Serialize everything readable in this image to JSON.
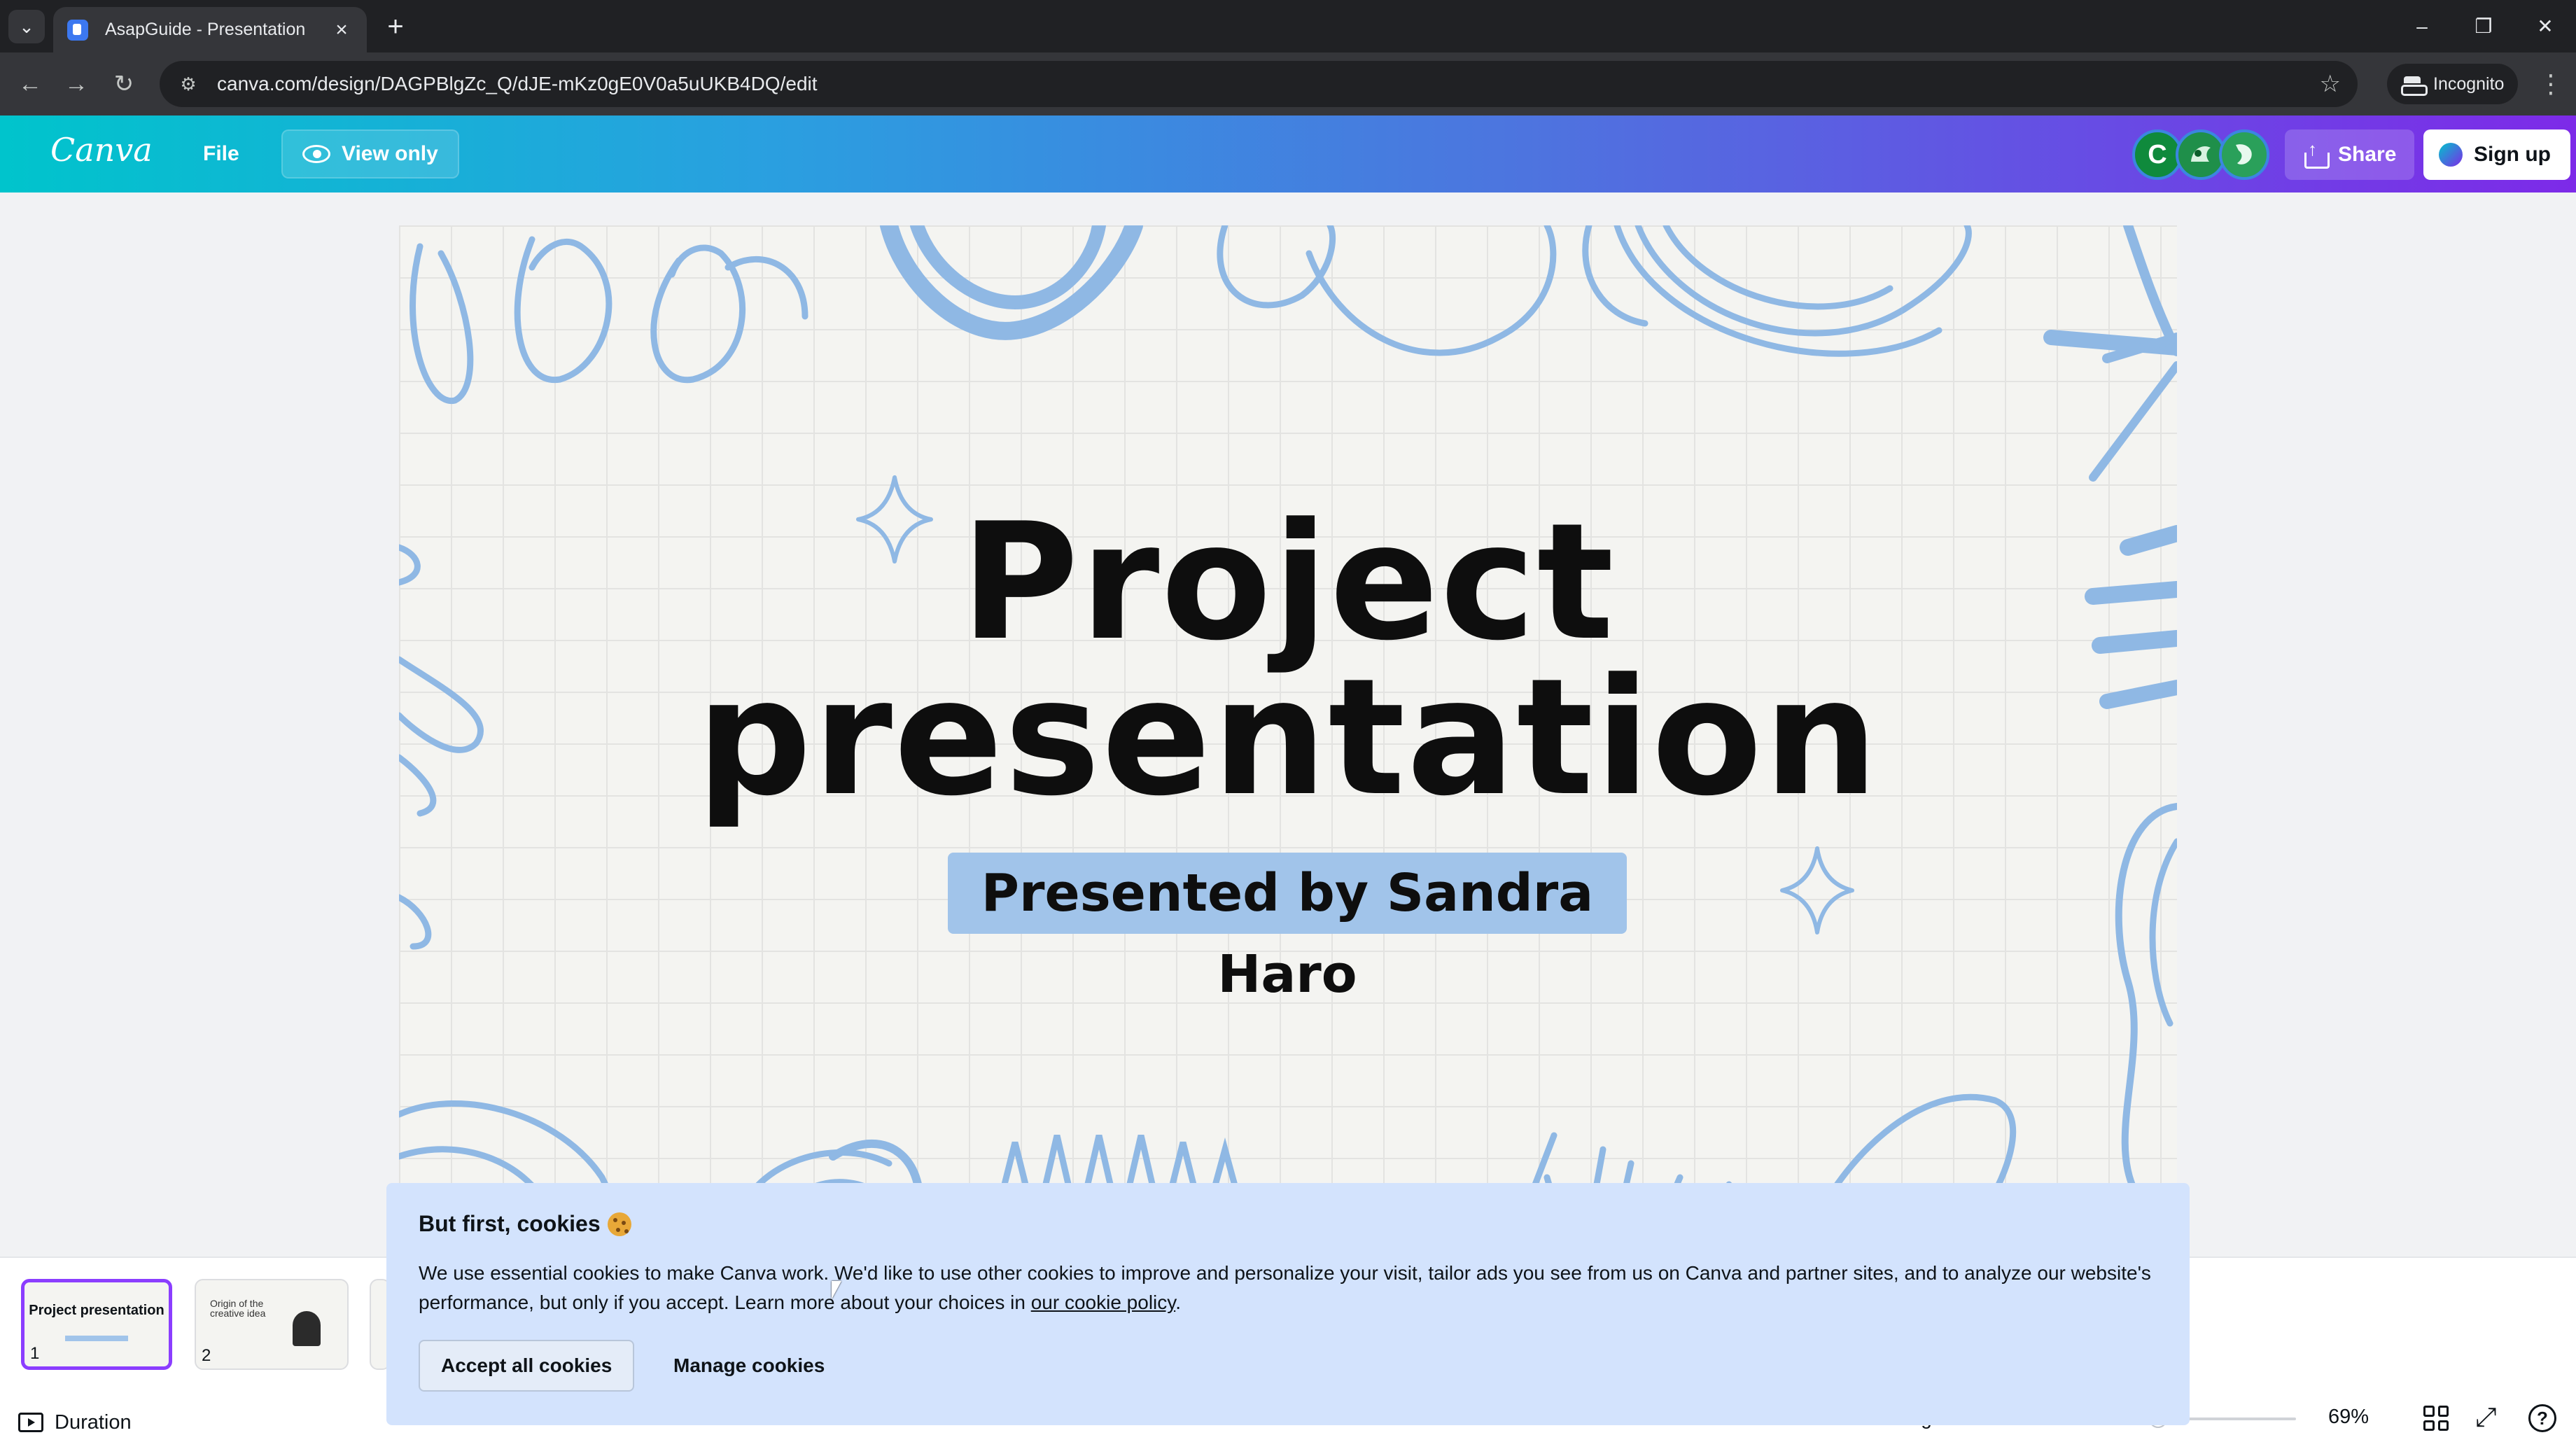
{
  "browser": {
    "tab_title": "AsapGuide - Presentation",
    "url": "canva.com/design/DAGPBlgZc_Q/dJE-mKz0gE0V0a5uUKB4DQ/edit",
    "incognito_label": "Incognito",
    "icons": [
      "tab-list-icon",
      "favicon-icon",
      "close-icon",
      "plus-icon",
      "minimize-icon",
      "restore-icon",
      "close-window-icon",
      "back-icon",
      "forward-icon",
      "reload-icon",
      "site-info-icon",
      "star-icon",
      "incognito-icon",
      "kebab-menu-icon"
    ]
  },
  "header": {
    "logo": "Canva",
    "file_label": "File",
    "view_only_label": "View only",
    "avatars": [
      {
        "initial": "C",
        "color": "#0f8a3c"
      },
      {
        "initial": "",
        "color": "#1f8f4a"
      },
      {
        "initial": "",
        "color": "#2aa05a"
      }
    ],
    "share_label": "Share",
    "signup_label": "Sign up",
    "gradient_colors": [
      "#00c4cc",
      "#4e73df",
      "#7d2ae8"
    ]
  },
  "slide": {
    "title_line1": "Project",
    "title_line2": "presentation",
    "subtitle": "Presented by Sandra Haro",
    "accent_color": "#a1c4ea",
    "doodle_color": "#8fb8e4"
  },
  "bottom": {
    "thumbnails": [
      {
        "number": "1",
        "title": "Project presentation",
        "active": true
      },
      {
        "number": "2",
        "title": "Origin of the creative idea",
        "active": false
      }
    ],
    "duration_label": "Duration",
    "page_indicator": "Page 1 / 12",
    "zoom": "69%"
  },
  "cookie": {
    "title": "But first, cookies",
    "text": "We use essential cookies to make Canva work. We'd like to use other cookies to improve and personalize your visit, tailor ads you see from us on Canva and partner sites, and to analyze our website's performance, but only if you accept. Learn more about your choices in",
    "link": "our cookie policy",
    "period": ".",
    "accept_label": "Accept all cookies",
    "manage_label": "Manage cookies"
  }
}
